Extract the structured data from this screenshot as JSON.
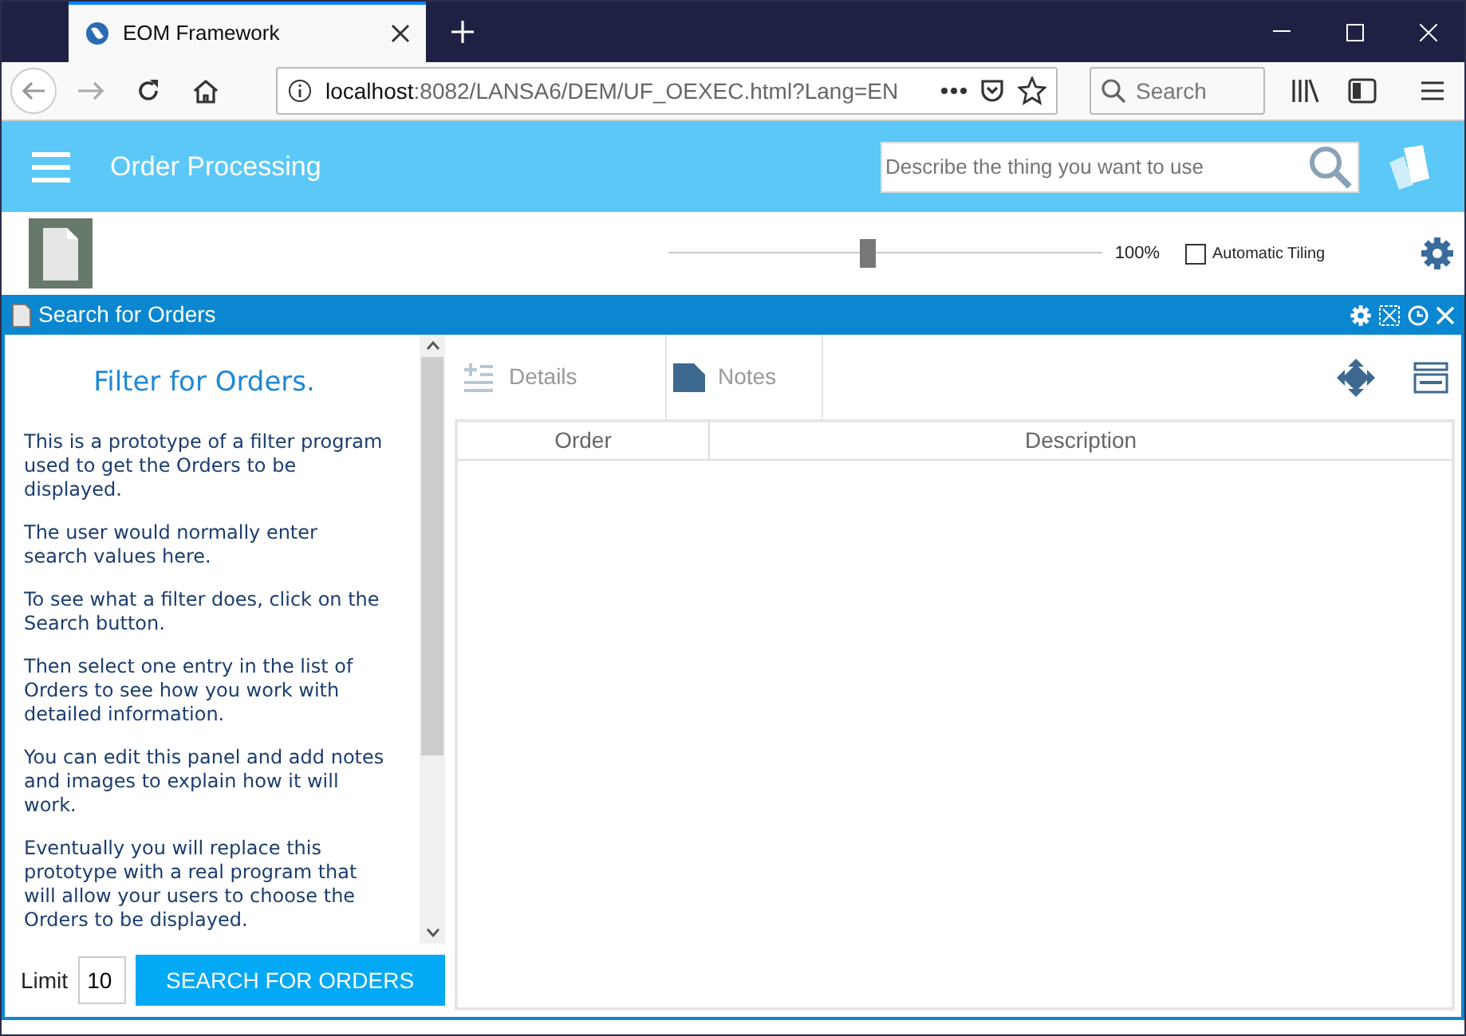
{
  "browser": {
    "tab_title": "EOM Framework",
    "url_host": "localhost",
    "url_rest": ":8082/LANSA6/DEM/UF_OEXEC.html?Lang=EN",
    "search_placeholder": "Search"
  },
  "app": {
    "title": "Order Processing",
    "search_placeholder": "Describe the thing you want to use"
  },
  "toolbar": {
    "zoom": {
      "level": 0.46,
      "reading": "100%"
    },
    "auto_tiling": {
      "label": "Automatic Tiling",
      "checked": false
    }
  },
  "panel": {
    "title": "Search for Orders",
    "filter": {
      "heading": "Filter for Orders.",
      "paragraphs": [
        "This is a prototype of a filter program used to get the Orders to be displayed.",
        "The user would normally enter search values here.",
        "To see what a filter does, click on the Search button.",
        "Then select one entry in the list of Orders to see how you work with detailed information.",
        "You can edit this panel and add notes and images to explain how it will work.",
        "Eventually you will replace this prototype with a real program that will allow your users to choose the Orders to be displayed."
      ],
      "limit_label": "Limit",
      "limit_value": "10",
      "button": "SEARCH FOR ORDERS"
    },
    "tabs": [
      {
        "label": "Details",
        "kind": "details"
      },
      {
        "label": "Notes",
        "kind": "notes"
      }
    ],
    "table": {
      "columns": [
        "Order",
        "Description"
      ]
    }
  }
}
